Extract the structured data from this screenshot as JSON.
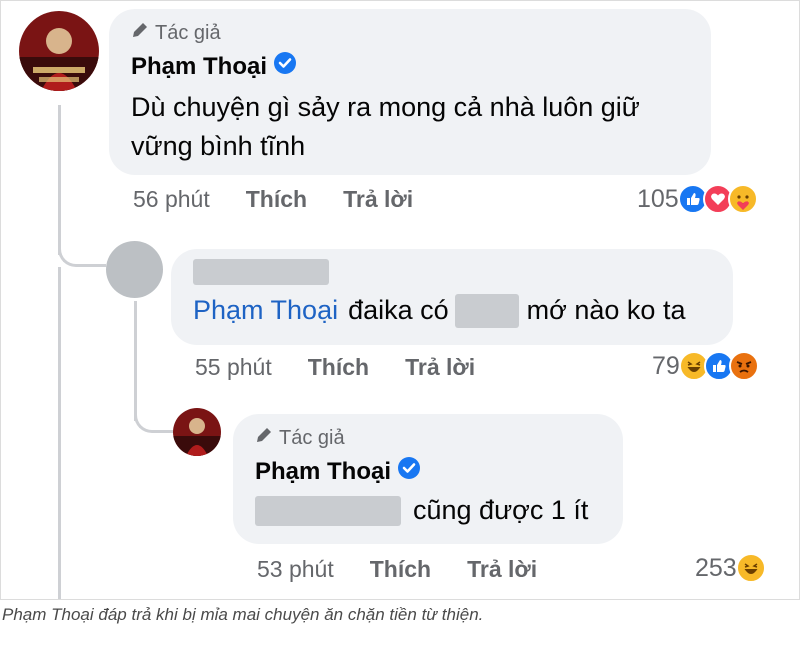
{
  "comments": [
    {
      "author_tag": "Tác giả",
      "author": "Phạm Thoại",
      "text_line1": "Dù chuyện gì sảy ra mong cả nhà luôn giữ",
      "text_line2": "vững bình tĩnh",
      "time": "56 phút",
      "like_label": "Thích",
      "reply_label": "Trả lời",
      "reaction_count": "105",
      "reactions": [
        "like",
        "love",
        "care"
      ]
    },
    {
      "mention": "Phạm Thoại",
      "text_before": "đaika có",
      "text_after": "mớ nào ko ta",
      "time": "55 phút",
      "like_label": "Thích",
      "reply_label": "Trả lời",
      "reaction_count": "79",
      "reactions": [
        "haha",
        "like",
        "angry"
      ]
    },
    {
      "author_tag": "Tác giả",
      "author": "Phạm Thoại",
      "text_after": "cũng được 1 ít",
      "time": "53 phút",
      "like_label": "Thích",
      "reply_label": "Trả lời",
      "reaction_count": "253",
      "reactions": [
        "haha"
      ]
    }
  ],
  "caption": "Phạm Thoại đáp trả khi bị mỉa mai chuyện ăn chặn tiền từ thiện.",
  "colors": {
    "bubble": "#f0f2f5",
    "mention": "#1e63c4",
    "verified": "#1877f2",
    "meta": "#65676b"
  }
}
